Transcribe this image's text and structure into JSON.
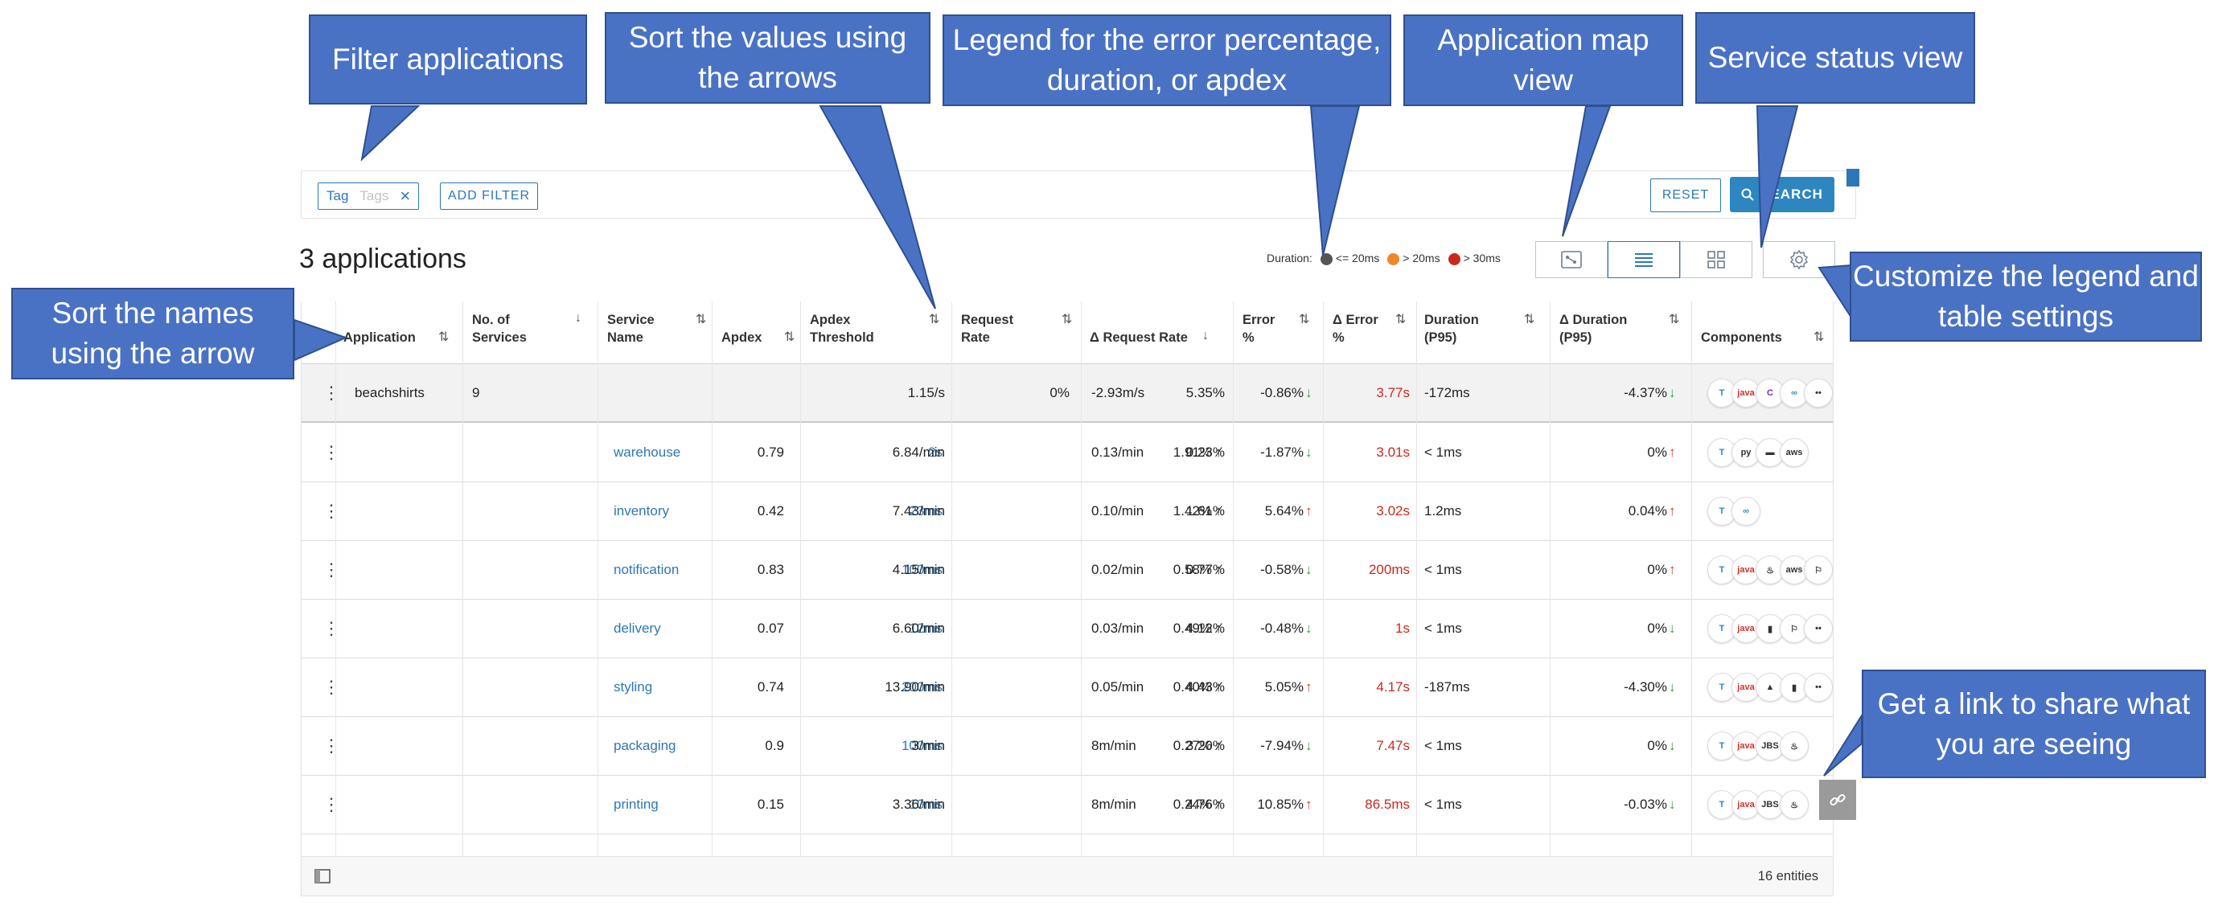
{
  "filter": {
    "chip_label": "Tag",
    "chip_placeholder": "Tags",
    "chip_close": "×",
    "add_filter": "ADD FILTER",
    "reset": "RESET",
    "search": "SEARCH"
  },
  "header": {
    "count_title": "3 applications",
    "legend_label": "Duration:",
    "legend_items": [
      {
        "label": "<= 20ms",
        "color": "#555555"
      },
      {
        "label": "> 20ms",
        "color": "#f0862a"
      },
      {
        "label": "> 30ms",
        "color": "#c8291f"
      }
    ]
  },
  "columns": [
    {
      "l1": "Application",
      "l2": "",
      "sort": "⇅"
    },
    {
      "l1": "No. of",
      "l2": "Services",
      "sort": "↓"
    },
    {
      "l1": "Service",
      "l2": "Name",
      "sort": "⇅"
    },
    {
      "l1": "Apdex",
      "l2": "",
      "sort": "⇅"
    },
    {
      "l1": "Apdex",
      "l2": "Threshold",
      "sort": "⇅"
    },
    {
      "l1": "Request",
      "l2": "Rate",
      "sort": "⇅"
    },
    {
      "l1": "Δ Request Rate",
      "l2": "",
      "sort": "↓"
    },
    {
      "l1": "Error",
      "l2": "%",
      "sort": "⇅"
    },
    {
      "l1": "Δ Error",
      "l2": "%",
      "sort": "⇅"
    },
    {
      "l1": "Duration",
      "l2": "(P95)",
      "sort": "⇅"
    },
    {
      "l1": "Δ Duration",
      "l2": "(P95)",
      "sort": "⇅"
    },
    {
      "l1": "Components",
      "l2": "",
      "sort": "⇅"
    }
  ],
  "parent_row": {
    "application": "beachshirts",
    "services": "9",
    "req_rate": "1.15/s",
    "d_req_abs": "-2.93m/s",
    "d_req_pct": "0%",
    "error": "5.35%",
    "d_error": "-0.86%",
    "d_error_dir": "↓",
    "duration": "3.77s",
    "d_dur_abs": "-172ms",
    "d_dur_pct": "-4.37%",
    "d_dur_dir": "↓",
    "comps": [
      "T",
      "java",
      "C",
      "∞",
      "••"
    ]
  },
  "rows": [
    {
      "service": "warehouse",
      "apdex": "0.79",
      "threshold": "2s",
      "req_rate": "6.84/min",
      "d_req_abs": "0.13/min",
      "d_req_pct": "1.91%",
      "d_req_dir": "↑",
      "error": "0.23%",
      "d_error": "-1.87%",
      "d_error_dir": "↓",
      "duration": "3.01s",
      "d_dur_abs": "< 1ms",
      "d_dur_pct": "0%",
      "d_dur_dir": "↑",
      "comps": [
        "T",
        "py",
        "▬",
        "aws"
      ]
    },
    {
      "service": "inventory",
      "apdex": "0.42",
      "threshold": "23ms",
      "req_rate": "7.43/min",
      "d_req_abs": "0.10/min",
      "d_req_pct": "1.42%",
      "d_req_dir": "↑",
      "error": "1.61%",
      "d_error": "5.64%",
      "d_error_dir": "↑",
      "duration": "3.02s",
      "d_dur_abs": "1.2ms",
      "d_dur_pct": "0.04%",
      "d_dur_dir": "↑",
      "comps": [
        "T",
        "∞"
      ]
    },
    {
      "service": "notification",
      "apdex": "0.83",
      "threshold": "100ms",
      "req_rate": "4.15/min",
      "d_req_abs": "0.02/min",
      "d_req_pct": "0.58%",
      "d_req_dir": "↑",
      "error": "0.77%",
      "d_error": "-0.58%",
      "d_error_dir": "↓",
      "duration": "200ms",
      "d_dur_abs": "< 1ms",
      "d_dur_pct": "0%",
      "d_dur_dir": "↑",
      "comps": [
        "T",
        "java",
        "♨",
        "aws",
        "⚐"
      ]
    },
    {
      "service": "delivery",
      "apdex": "0.07",
      "threshold": "12ms",
      "req_rate": "6.60/min",
      "d_req_abs": "0.03/min",
      "d_req_pct": "0.49%",
      "d_req_dir": "↑",
      "error": "4.12%",
      "d_error": "-0.48%",
      "d_error_dir": "↓",
      "duration": "1s",
      "d_dur_abs": "< 1ms",
      "d_dur_pct": "0%",
      "d_dur_dir": "↓",
      "comps": [
        "T",
        "java",
        "▮",
        "⚐",
        "••"
      ]
    },
    {
      "service": "styling",
      "apdex": "0.74",
      "threshold": "200ms",
      "req_rate": "13.90/min",
      "d_req_abs": "0.05/min",
      "d_req_pct": "0.40%",
      "d_req_dir": "↑",
      "error": "4.43%",
      "d_error": "5.05%",
      "d_error_dir": "↑",
      "duration": "4.17s",
      "d_dur_abs": "-187ms",
      "d_dur_pct": "-4.30%",
      "d_dur_dir": "↓",
      "comps": [
        "T",
        "java",
        "▲",
        "▮",
        "••"
      ]
    },
    {
      "service": "packaging",
      "apdex": "0.9",
      "threshold": "100ms",
      "req_rate": "3/min",
      "d_req_abs": "8m/min",
      "d_req_pct": "0.27%",
      "d_req_dir": "↑",
      "error": "3.20%",
      "d_error": "-7.94%",
      "d_error_dir": "↓",
      "duration": "7.47s",
      "d_dur_abs": "< 1ms",
      "d_dur_pct": "0%",
      "d_dur_dir": "↓",
      "comps": [
        "T",
        "java",
        "JBS",
        "♨"
      ]
    },
    {
      "service": "printing",
      "apdex": "0.15",
      "threshold": "10ms",
      "req_rate": "3.36/min",
      "d_req_abs": "8m/min",
      "d_req_pct": "0.24%",
      "d_req_dir": "↑",
      "error": "4.76%",
      "d_error": "10.85%",
      "d_error_dir": "↑",
      "duration": "86.5ms",
      "d_dur_abs": "< 1ms",
      "d_dur_pct": "-0.03%",
      "d_dur_dir": "↓",
      "comps": [
        "T",
        "java",
        "JBS",
        "♨"
      ]
    }
  ],
  "footer": {
    "entities": "16 entities"
  },
  "callouts": {
    "filter": "Filter applications",
    "sort_values": "Sort the values using the arrows",
    "legend": "Legend for the error percentage, duration, or apdex",
    "app_map": "Application map view",
    "service_status": "Service status view",
    "customize": "Customize the legend and table settings",
    "sort_names": "Sort the names using the arrow",
    "share_link": "Get a link to share what you are seeing"
  },
  "colors": {
    "callout_fill": "#4a72c4",
    "accent": "#2d77b6",
    "link": "#2f76b3",
    "duration_red": "#c8291f",
    "up_arrow": "#d0312a",
    "down_arrow": "#2e9e3d"
  },
  "icons": {
    "search": "search-icon",
    "app_map": "app-map-icon",
    "list": "list-icon",
    "grid": "grid-icon",
    "settings": "gear-icon",
    "link": "link-icon",
    "panel": "panel-toggle-icon",
    "kebab": "kebab-menu-icon"
  }
}
